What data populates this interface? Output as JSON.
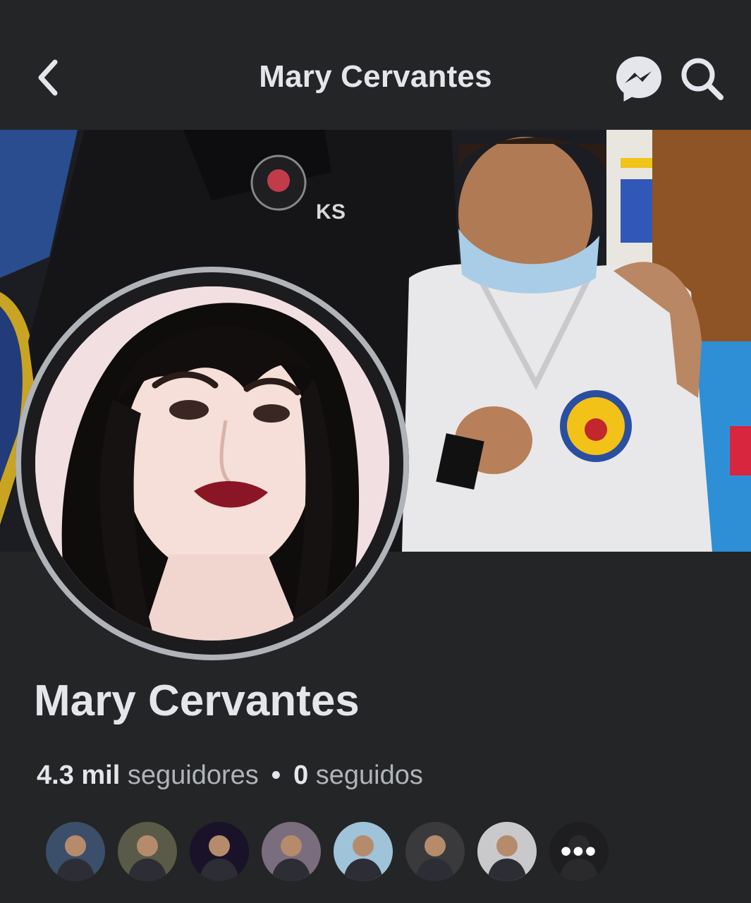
{
  "header": {
    "back_icon": "chevron-left-icon",
    "title": "Mary Cervantes",
    "messenger_icon": "messenger-icon",
    "search_icon": "search-icon"
  },
  "profile": {
    "name": "Mary Cervantes",
    "followers_count": "4.3 mil",
    "followers_label": "seguidores",
    "separator": "•",
    "following_count": "0",
    "following_label": "seguidos"
  },
  "followers_preview": [
    {
      "icon": "avatar-man-cap",
      "color": "#3b4f6b"
    },
    {
      "icon": "avatar-soldier",
      "color": "#5a5a48"
    },
    {
      "icon": "avatar-text-quote",
      "color": "#1a1228"
    },
    {
      "icon": "avatar-couple",
      "color": "#7a6d7e"
    },
    {
      "icon": "avatar-beach",
      "color": "#9fc3d8"
    },
    {
      "icon": "avatar-mirror-selfie",
      "color": "#3a3a3c"
    },
    {
      "icon": "avatar-man-cap-white",
      "color": "#c9c9cc"
    },
    {
      "icon": "avatar-dark",
      "color": "#1e1e20"
    }
  ],
  "more_label": "•••",
  "colors": {
    "background": "#242526",
    "text_primary": "#e4e6eb",
    "text_secondary": "#b0b3b8"
  }
}
